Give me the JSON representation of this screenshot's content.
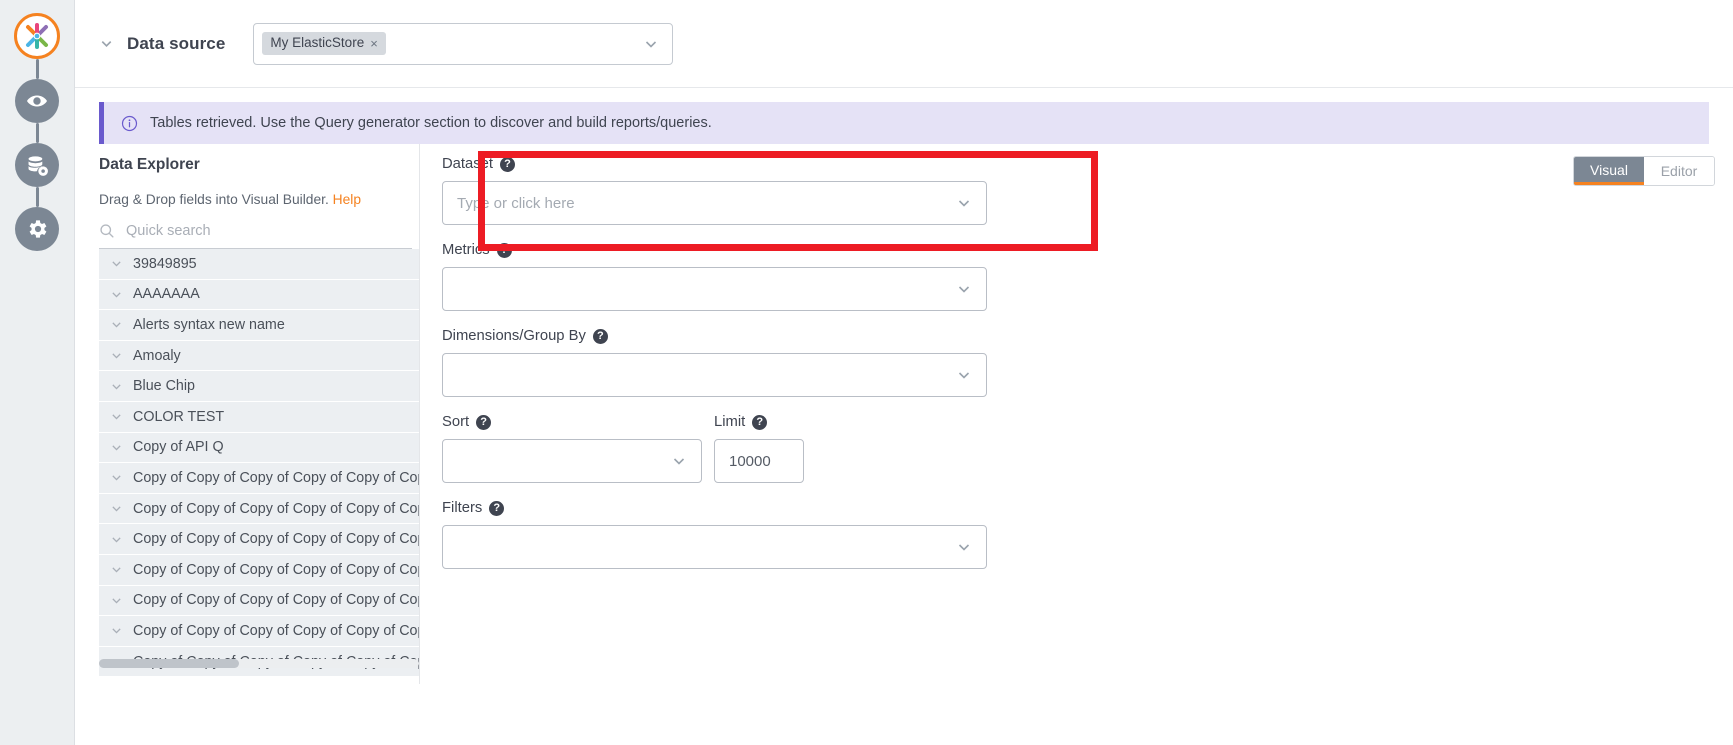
{
  "rail": {
    "logo_name": "app-logo",
    "items": [
      {
        "name": "preview-eye-icon",
        "label": "Preview"
      },
      {
        "name": "database-settings-icon",
        "label": "Data sources"
      },
      {
        "name": "settings-gear-icon",
        "label": "Settings"
      }
    ]
  },
  "data_source": {
    "caret": "chevron-down",
    "label": "Data source",
    "chip": "My ElasticStore",
    "chip_remove": "×"
  },
  "banner": {
    "icon": "info",
    "text": "Tables retrieved. Use the Query generator section to discover and build reports/queries.",
    "bg": "#e5e2f6",
    "accent": "#6a5acd"
  },
  "explorer": {
    "title": "Data Explorer",
    "subtitle": "Drag & Drop fields into Visual Builder.",
    "help_label": "Help",
    "help_color": "#f58220",
    "search_placeholder": "Quick search",
    "items": [
      "39849895",
      "AAAAAAA",
      "Alerts syntax new name",
      "Amoaly",
      "Blue Chip",
      "COLOR TEST",
      "Copy of API Q",
      "Copy of Copy of Copy of Copy of Copy of Copy",
      "Copy of Copy of Copy of Copy of Copy of Copy",
      "Copy of Copy of Copy of Copy of Copy of Copy",
      "Copy of Copy of Copy of Copy of Copy of Copy",
      "Copy of Copy of Copy of Copy of Copy of Copy",
      "Copy of Copy of Copy of Copy of Copy of Copy",
      "Copy of Copy of Copy of Copy of Copy of Copy"
    ]
  },
  "query_form": {
    "dataset": {
      "label": "Dataset",
      "placeholder": "Type or click here",
      "value": ""
    },
    "metrics": {
      "label": "Metrics",
      "value": ""
    },
    "dimensions": {
      "label": "Dimensions/Group By",
      "value": ""
    },
    "sort": {
      "label": "Sort",
      "value": ""
    },
    "limit": {
      "label": "Limit",
      "value": "10000"
    },
    "filters": {
      "label": "Filters",
      "value": ""
    },
    "toggle": {
      "visual": "Visual",
      "editor": "Editor",
      "active": "Visual",
      "active_accent": "#f58220"
    }
  },
  "highlight": {
    "name": "dataset-highlight",
    "color": "#ed1c24"
  }
}
